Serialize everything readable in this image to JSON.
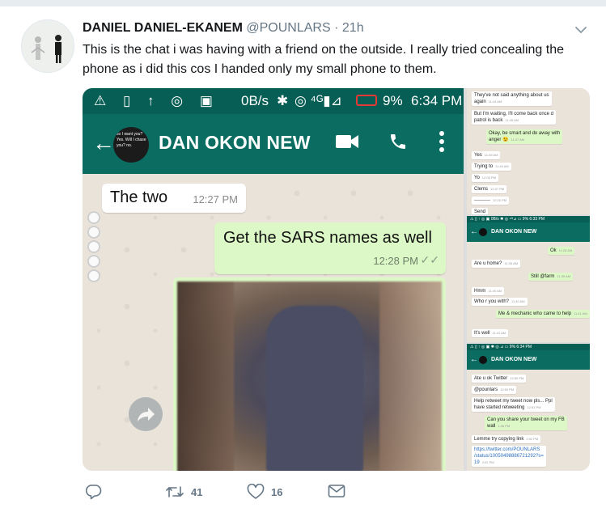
{
  "tweet": {
    "display_name": "DANIEL DANIEL-EKANEM",
    "handle": "@POUNLARS",
    "separator": "·",
    "time": "21h",
    "text": "This is the chat i was having with a friend on the outside. I really tried concealing the phone as i did this cos I handed only my small phone to them."
  },
  "main_screenshot": {
    "status_left": "⚠ ▯ ↑ ◎ ▣",
    "data_rate": "0B/s",
    "battery": "9%",
    "clock": "6:34 PM",
    "contact_avatar_text": "so I want you? Yes. Will I chase you? no.",
    "contact_name": "DAN OKON NEW",
    "messages": [
      {
        "direction": "in",
        "text": "The two",
        "time": "12:27 PM"
      },
      {
        "direction": "out",
        "text": "Get the SARS names as well",
        "time": "12:28 PM"
      }
    ]
  },
  "strip_top": {
    "messages": [
      {
        "dir": "in",
        "text": "They've not said anything about us",
        "text2": "again",
        "time": "11:44 AM"
      },
      {
        "dir": "in",
        "text": "But I'm waiting, I'll come back once d",
        "text2": "patrol is back",
        "time": "11:45 AM"
      },
      {
        "dir": "out",
        "text": "Okay, be smart and do away with",
        "text2": "anger 😉",
        "time": "11:47 AM"
      },
      {
        "dir": "in",
        "text": "Yes",
        "time": "11:49 AM"
      },
      {
        "dir": "in",
        "text": "Trying to",
        "time": "11:49 AM"
      },
      {
        "dir": "in",
        "text": "Yo",
        "time": "12:05 PM"
      },
      {
        "dir": "in",
        "text": "Clems",
        "time": "12:07 PM"
      },
      {
        "dir": "in",
        "text": "----------",
        "time": "12:20 PM"
      },
      {
        "dir": "in",
        "text": "Send",
        "time": ""
      }
    ]
  },
  "strip_mid": {
    "status": "⚠ ▯ ↑ ◎ ▣        0B/s ✱ ◎ ⁴ᴳ⊿ ▭ 9% 6:33 PM",
    "contact_name": "DAN OKON NEW",
    "messages": [
      {
        "dir": "out",
        "text": "Ok",
        "time": "11:28 AM"
      },
      {
        "dir": "in",
        "text": "Are u home?",
        "time": "11:39 AM"
      },
      {
        "dir": "out",
        "text": "Still @farm",
        "time": "11:39 AM"
      },
      {
        "dir": "in",
        "text": "Hmm",
        "time": "11:40 AM"
      },
      {
        "dir": "in",
        "text": "Who r you with?",
        "time": "11:40 AM"
      },
      {
        "dir": "out",
        "text": "Me & mechanic who came to help",
        "time": "11:41 AM"
      },
      {
        "dir": "in",
        "text": "It's well",
        "time": "11:41 AM"
      }
    ]
  },
  "strip_bottom": {
    "status": "⚠ ▯ ↑ ◎ ▣        ✱ ◎ ⊿ ▭ 9% 6:34 PM",
    "contact_name": "DAN OKON NEW",
    "messages": [
      {
        "dir": "in",
        "text": "Ate u ok Twitter",
        "time": "12:50 PM"
      },
      {
        "dir": "in",
        "text": "@pounlars",
        "time": "12:50 PM"
      },
      {
        "dir": "in",
        "text": "Help retweet my tweet now pls... Ppl",
        "text2": "have started retweeting",
        "time": "12:51 PM"
      },
      {
        "dir": "out",
        "text": "Can you share your tweet on my FB",
        "text2": "wall",
        "time": "1:46 PM"
      },
      {
        "dir": "in",
        "text": "Lemme try copying link",
        "time": "2:02 PM"
      },
      {
        "dir": "in",
        "link": "https://twitter.com/POUNLARS",
        "link2": "/status/10050498886721292?s=",
        "link3": "19",
        "time": "2:02 PM"
      }
    ]
  },
  "actions": {
    "reply_count": "",
    "retweet_count": "41",
    "like_count": "16"
  },
  "colors": {
    "whatsapp_header": "#0b6d61",
    "outgoing_bubble": "#dcf8c6",
    "twitter_gray": "#657786"
  }
}
